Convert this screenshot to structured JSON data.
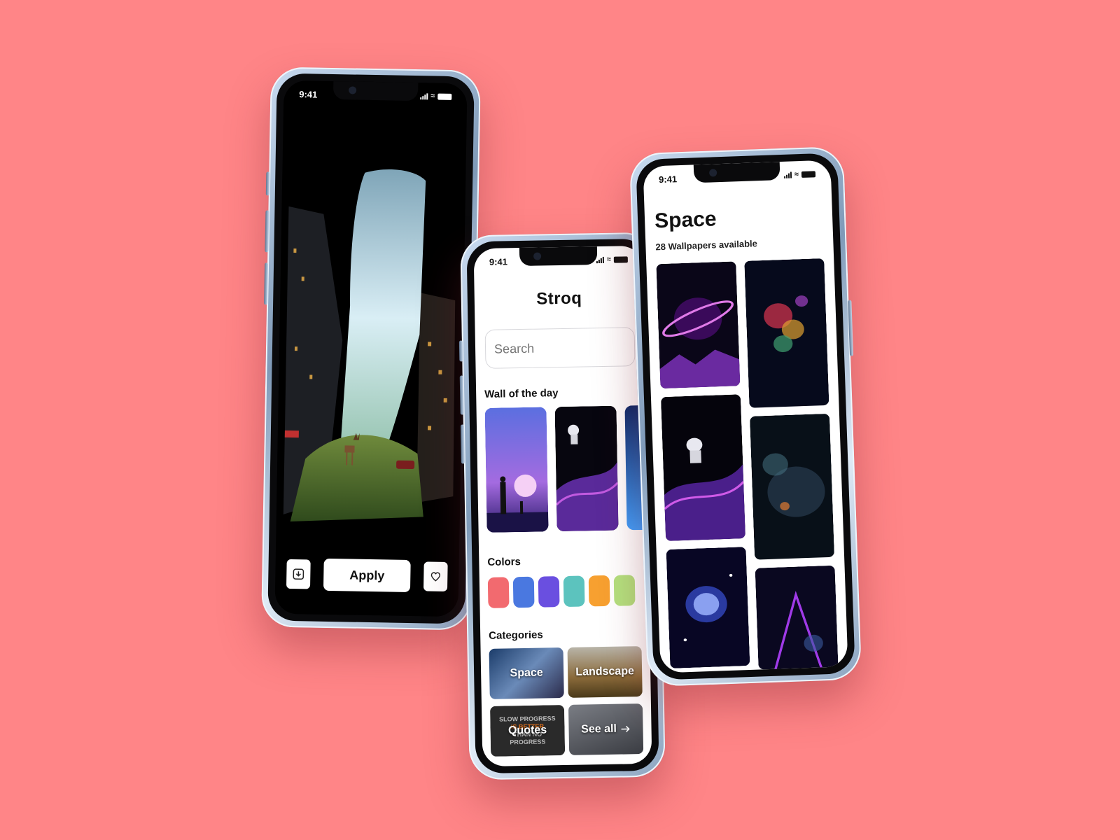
{
  "status_time": "9:41",
  "detail_screen": {
    "apply_label": "Apply",
    "download_icon": "download-icon",
    "favorite_icon": "heart-icon"
  },
  "home_screen": {
    "app_name": "Stroq",
    "search": {
      "placeholder": "Search",
      "value": ""
    },
    "wall_of_day_title": "Wall of the day",
    "colors_title": "Colors",
    "colors": [
      "#f26a6f",
      "#4a78e0",
      "#6a4fe0",
      "#5cc3be",
      "#f7a030",
      "#b4e07e"
    ],
    "categories_title": "Categories",
    "categories": [
      {
        "label": "Space"
      },
      {
        "label": "Landscape"
      },
      {
        "label": "Quotes",
        "art_text": [
          "SLOW PROGRESS",
          "IS BETTER",
          "THAN NO",
          "PROGRESS"
        ]
      },
      {
        "label": "See all"
      }
    ]
  },
  "category_screen": {
    "title": "Space",
    "subtitle": "28 Wallpapers available"
  },
  "colors": {
    "background": "#ff8587",
    "frame": "#8aa3bf"
  }
}
